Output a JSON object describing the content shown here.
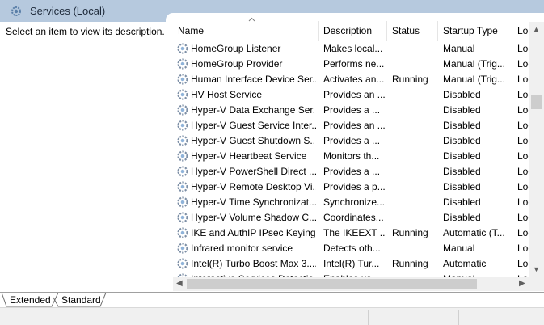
{
  "header": {
    "title": "Services (Local)"
  },
  "description": {
    "text": "Select an item to view its description."
  },
  "columns": [
    {
      "label": "Name"
    },
    {
      "label": "Description"
    },
    {
      "label": "Status"
    },
    {
      "label": "Startup Type"
    },
    {
      "label": "Lo"
    }
  ],
  "rows": [
    {
      "name": "HomeGroup Listener",
      "description": "Makes local...",
      "status": "",
      "startup": "Manual",
      "logon": "Loc"
    },
    {
      "name": "HomeGroup Provider",
      "description": "Performs ne...",
      "status": "",
      "startup": "Manual (Trig...",
      "logon": "Loc"
    },
    {
      "name": "Human Interface Device Ser...",
      "description": "Activates an...",
      "status": "Running",
      "startup": "Manual (Trig...",
      "logon": "Loc"
    },
    {
      "name": "HV Host Service",
      "description": "Provides an ...",
      "status": "",
      "startup": "Disabled",
      "logon": "Loc"
    },
    {
      "name": "Hyper-V Data Exchange Ser...",
      "description": "Provides a ...",
      "status": "",
      "startup": "Disabled",
      "logon": "Loc"
    },
    {
      "name": "Hyper-V Guest Service Inter...",
      "description": "Provides an ...",
      "status": "",
      "startup": "Disabled",
      "logon": "Loc"
    },
    {
      "name": "Hyper-V Guest Shutdown S...",
      "description": "Provides a ...",
      "status": "",
      "startup": "Disabled",
      "logon": "Loc"
    },
    {
      "name": "Hyper-V Heartbeat Service",
      "description": "Monitors th...",
      "status": "",
      "startup": "Disabled",
      "logon": "Loc"
    },
    {
      "name": "Hyper-V PowerShell Direct ...",
      "description": "Provides a ...",
      "status": "",
      "startup": "Disabled",
      "logon": "Loc"
    },
    {
      "name": "Hyper-V Remote Desktop Vi...",
      "description": "Provides a p...",
      "status": "",
      "startup": "Disabled",
      "logon": "Loc"
    },
    {
      "name": "Hyper-V Time Synchronizat...",
      "description": "Synchronize...",
      "status": "",
      "startup": "Disabled",
      "logon": "Loc"
    },
    {
      "name": "Hyper-V Volume Shadow C...",
      "description": "Coordinates...",
      "status": "",
      "startup": "Disabled",
      "logon": "Loc"
    },
    {
      "name": "IKE and AuthIP IPsec Keying...",
      "description": "The IKEEXT ...",
      "status": "Running",
      "startup": "Automatic (T...",
      "logon": "Loc"
    },
    {
      "name": "Infrared monitor service",
      "description": "Detects oth...",
      "status": "",
      "startup": "Manual",
      "logon": "Loc"
    },
    {
      "name": "Intel(R) Turbo Boost Max 3....",
      "description": "Intel(R) Tur...",
      "status": "Running",
      "startup": "Automatic",
      "logon": "Loc"
    },
    {
      "name": "Interactive Services Detectio...",
      "description": "Enables us...",
      "status": "",
      "startup": "Manual",
      "logon": "Loc"
    }
  ],
  "tabs": [
    {
      "label": "Extended"
    },
    {
      "label": "Standard"
    }
  ],
  "colors": {
    "header_bg": "#b6c9de",
    "scroll_bg": "#f0f0f0",
    "scroll_thumb": "#cdcdcd"
  }
}
